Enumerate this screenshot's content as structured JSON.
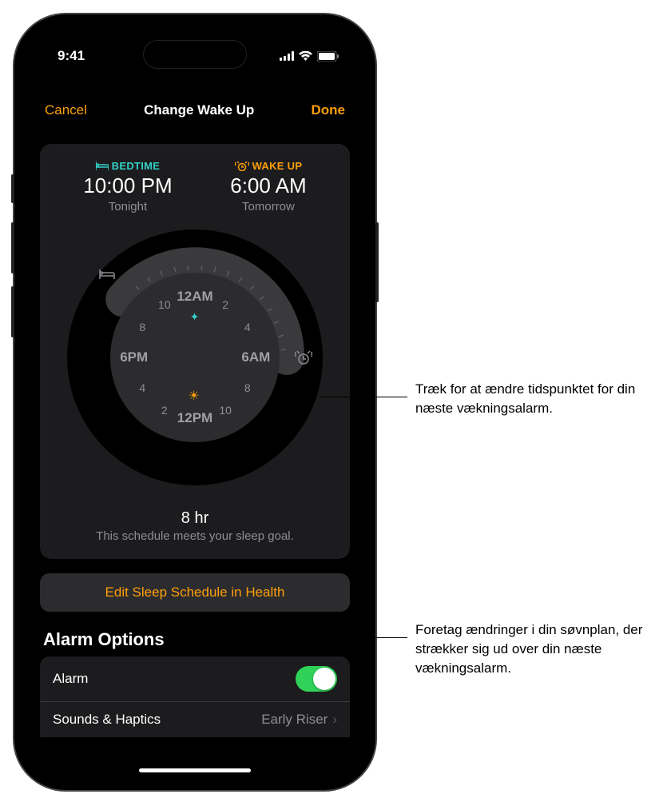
{
  "statusBar": {
    "time": "9:41"
  },
  "nav": {
    "cancel": "Cancel",
    "title": "Change Wake Up",
    "done": "Done"
  },
  "bedtime": {
    "label": "BEDTIME",
    "time": "10:00 PM",
    "sub": "Tonight"
  },
  "wakeup": {
    "label": "WAKE UP",
    "time": "6:00 AM",
    "sub": "Tomorrow"
  },
  "clock": {
    "top": "12AM",
    "right": "6AM",
    "bottom": "12PM",
    "left": "6PM",
    "n2a": "2",
    "n4a": "4",
    "n8a": "8",
    "n10a": "10",
    "n2b": "2",
    "n4b": "4",
    "n8b": "8",
    "n10b": "10"
  },
  "duration": {
    "hours": "8 hr",
    "sub": "This schedule meets your sleep goal."
  },
  "editButton": "Edit Sleep Schedule in Health",
  "alarmOptions": {
    "title": "Alarm Options",
    "alarmLabel": "Alarm",
    "soundsLabel": "Sounds & Haptics",
    "soundsValue": "Early Riser"
  },
  "callouts": {
    "wake": "Træk for at ændre tidspunktet for din næste vækningsalarm.",
    "edit": "Foretag ændringer i din søvnplan, der strækker sig ud over din næste vækningsalarm."
  }
}
